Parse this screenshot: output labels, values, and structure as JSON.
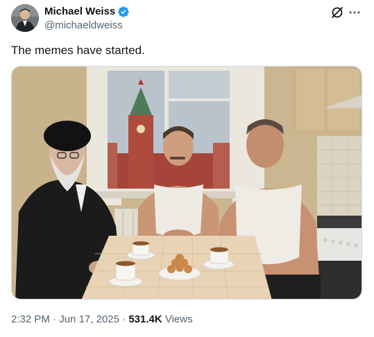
{
  "author": {
    "name": "Michael Weiss",
    "handle": "@michaeldweiss",
    "verified": true,
    "verified_color": "#1d9bf0"
  },
  "icons": {
    "grok": "grok-icon",
    "more": "more-icon",
    "verified": "verified-badge-icon"
  },
  "tweet": {
    "text": "The memes have started."
  },
  "media": {
    "type": "photo"
  },
  "meta": {
    "time": "2:32 PM",
    "separator_1": " · ",
    "date": "Jun 17, 2025",
    "separator_2": " · ",
    "views_count": "531.4K",
    "views_label": " Views"
  },
  "colors": {
    "text_primary": "#0f1419",
    "text_secondary": "#536471",
    "border": "#cfd9de"
  }
}
